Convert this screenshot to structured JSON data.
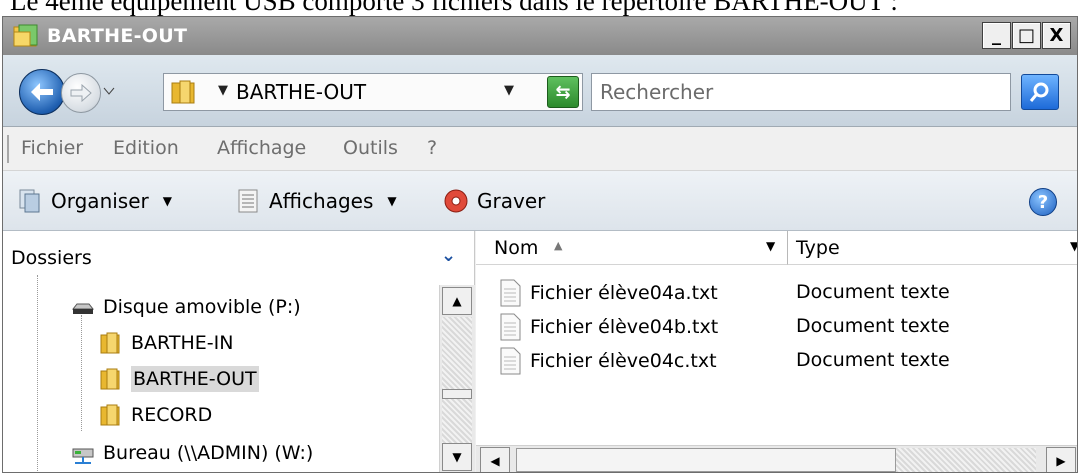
{
  "caption": "Le 4ème équipement USB comporte 3 fichiers dans le répertoire BARTHE-OUT :",
  "window": {
    "title": "BARTHE-OUT",
    "minimize": "_",
    "maximize": "□",
    "close": "X"
  },
  "address": {
    "path": "BARTHE-OUT",
    "search_placeholder": "Rechercher"
  },
  "menu": [
    "Fichier",
    "Edition",
    "Affichage",
    "Outils",
    "?"
  ],
  "toolbar": {
    "organise": "Organiser",
    "views": "Affichages",
    "burn": "Graver",
    "help": "?"
  },
  "sidebar": {
    "header": "Dossiers",
    "items": [
      {
        "label": "Disque amovible (P:)",
        "icon": "removable-drive-icon"
      },
      {
        "label": "BARTHE-IN",
        "icon": "folder-icon"
      },
      {
        "label": "BARTHE-OUT",
        "icon": "folder-icon",
        "selected": true
      },
      {
        "label": "RECORD",
        "icon": "folder-icon"
      },
      {
        "label": "Bureau (\\\\ADMIN) (W:)",
        "icon": "network-drive-icon"
      }
    ]
  },
  "file_list": {
    "columns": [
      "Nom",
      "Type"
    ],
    "rows": [
      {
        "name": "Fichier élève04a.txt",
        "type": "Document texte"
      },
      {
        "name": "Fichier élève04b.txt",
        "type": "Document texte"
      },
      {
        "name": "Fichier élève04c.txt",
        "type": "Document texte"
      }
    ]
  },
  "colors": {
    "titlebar": "#9a9a9a",
    "accent_blue": "#1d6ad8",
    "folder_yellow": "#e8b730"
  }
}
